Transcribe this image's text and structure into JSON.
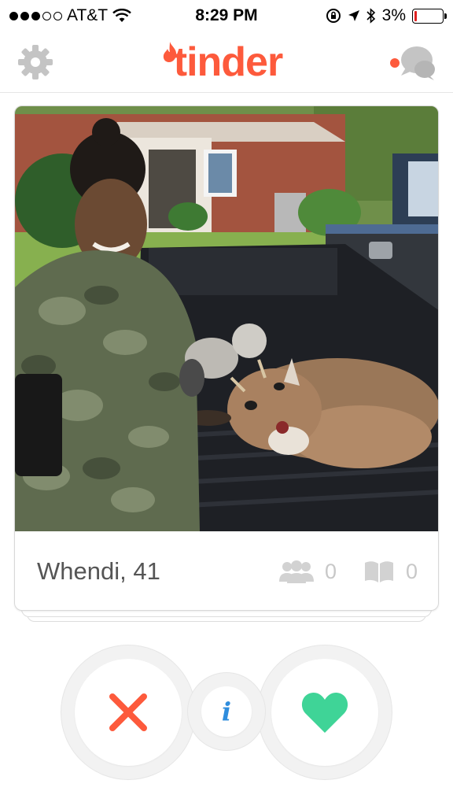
{
  "status_bar": {
    "carrier": "AT&T",
    "time": "8:29 PM",
    "battery": "3%",
    "signal_bars_filled": 3,
    "signal_bars_total": 5,
    "battery_level": 0.03
  },
  "header": {
    "logo_text": "tinder",
    "left_icon": "gear-icon",
    "right_icon": "chat-bubbles-icon",
    "brand_color": "#fd5a3c"
  },
  "profile": {
    "name_age": "Whendi, 41",
    "shared_friends_count": "0",
    "shared_interests_count": "0"
  },
  "actions": {
    "dislike_icon": "close-x-icon",
    "info_icon": "info-icon",
    "info_label": "i",
    "like_icon": "heart-icon",
    "dislike_color": "#fd5a3c",
    "like_color": "#3fd497",
    "info_color": "#2f8ddd"
  }
}
